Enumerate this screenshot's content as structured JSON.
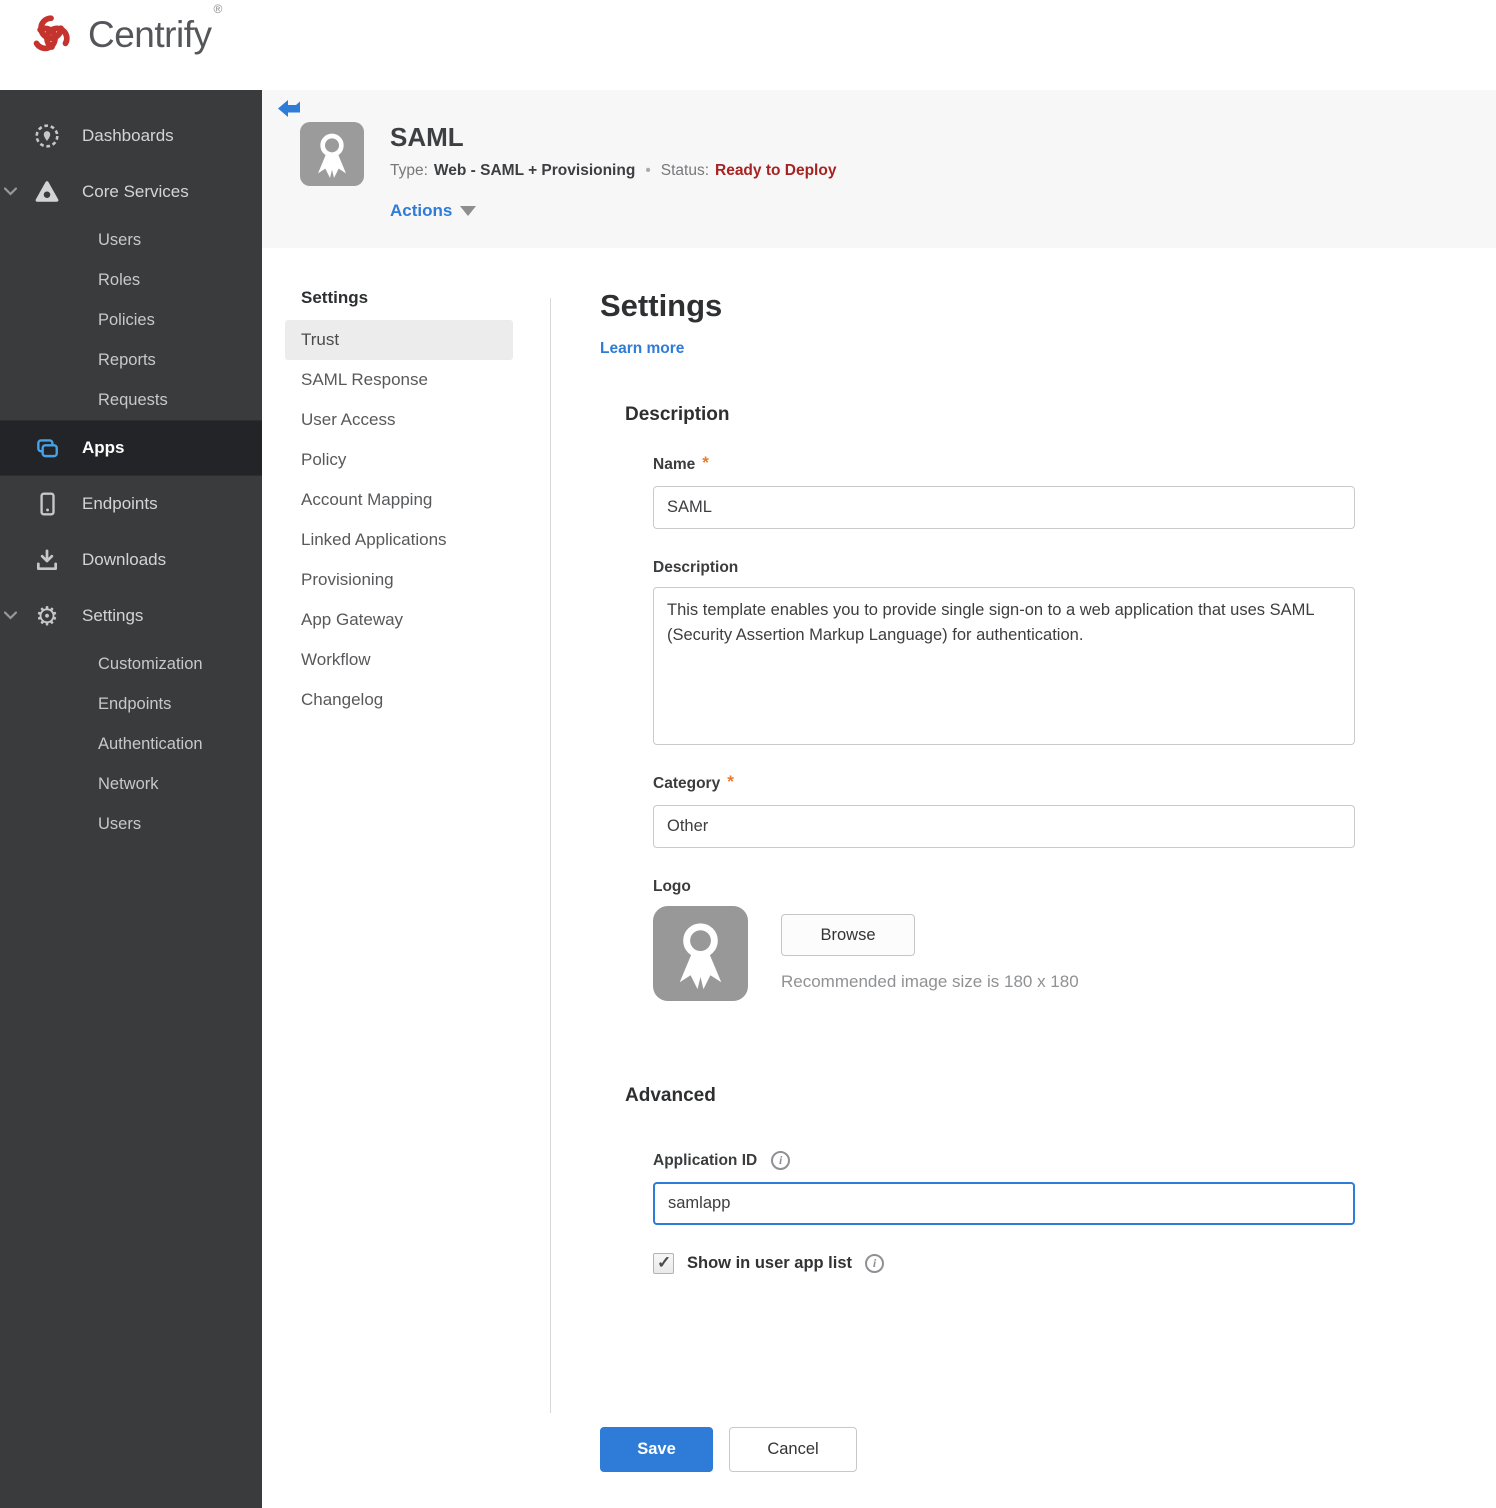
{
  "brand": {
    "name": "Centrify",
    "mark": "®",
    "logo_color": "#c5332f"
  },
  "sidebar": {
    "items": [
      {
        "label": "Dashboards",
        "icon": "dashboard",
        "level": 1,
        "active": false
      },
      {
        "label": "Core Services",
        "icon": "core-services",
        "level": 1,
        "active": false,
        "expanded": true
      },
      {
        "label": "Users",
        "level": 2,
        "active": false
      },
      {
        "label": "Roles",
        "level": 2,
        "active": false
      },
      {
        "label": "Policies",
        "level": 2,
        "active": false
      },
      {
        "label": "Reports",
        "level": 2,
        "active": false
      },
      {
        "label": "Requests",
        "level": 2,
        "active": false
      },
      {
        "label": "Apps",
        "icon": "apps",
        "level": 1,
        "active": true
      },
      {
        "label": "Endpoints",
        "icon": "endpoint",
        "level": 1,
        "active": false
      },
      {
        "label": "Downloads",
        "icon": "download",
        "level": 1,
        "active": false
      },
      {
        "label": "Settings",
        "icon": "gear",
        "level": 1,
        "active": false,
        "expanded": true
      },
      {
        "label": "Customization",
        "level": 2,
        "active": false
      },
      {
        "label": "Endpoints",
        "level": 2,
        "active": false
      },
      {
        "label": "Authentication",
        "level": 2,
        "active": false
      },
      {
        "label": "Network",
        "level": 2,
        "active": false
      },
      {
        "label": "Users",
        "level": 2,
        "active": false
      }
    ]
  },
  "app_header": {
    "title": "SAML",
    "type_label": "Type:",
    "type_value": "Web - SAML + Provisioning",
    "separator": "•",
    "status_label": "Status:",
    "status_value": "Ready to Deploy",
    "status_color": "#a62321",
    "actions_label": "Actions"
  },
  "app_nav": {
    "heading": "Settings",
    "selected": "Trust",
    "items": [
      "Trust",
      "SAML Response",
      "User Access",
      "Policy",
      "Account Mapping",
      "Linked Applications",
      "Provisioning",
      "App Gateway",
      "Workflow",
      "Changelog"
    ]
  },
  "main": {
    "title": "Settings",
    "learn_more": "Learn more",
    "description_section": {
      "heading": "Description",
      "name_field": {
        "label": "Name",
        "required": "*",
        "value": "SAML"
      },
      "description_field": {
        "label": "Description",
        "value": "This template enables you to provide single sign-on to a web application that uses SAML (Security Assertion Markup Language) for authentication."
      },
      "category_field": {
        "label": "Category",
        "required": "*",
        "value": "Other"
      },
      "logo_field": {
        "label": "Logo",
        "browse_label": "Browse",
        "hint": "Recommended image size is 180 x 180"
      }
    },
    "advanced_section": {
      "heading": "Advanced",
      "application_id_field": {
        "label": "Application ID",
        "value": "samlapp",
        "focused": true
      },
      "show_in_user_app_list": {
        "label": "Show in user app list",
        "checked": true
      }
    },
    "buttons": {
      "save": "Save",
      "cancel": "Cancel"
    }
  },
  "colors": {
    "accent_blue": "#2e7cd7",
    "sidebar_bg": "#3a3b3d",
    "header_band": "#f7f7f8",
    "status_red": "#a62321"
  }
}
